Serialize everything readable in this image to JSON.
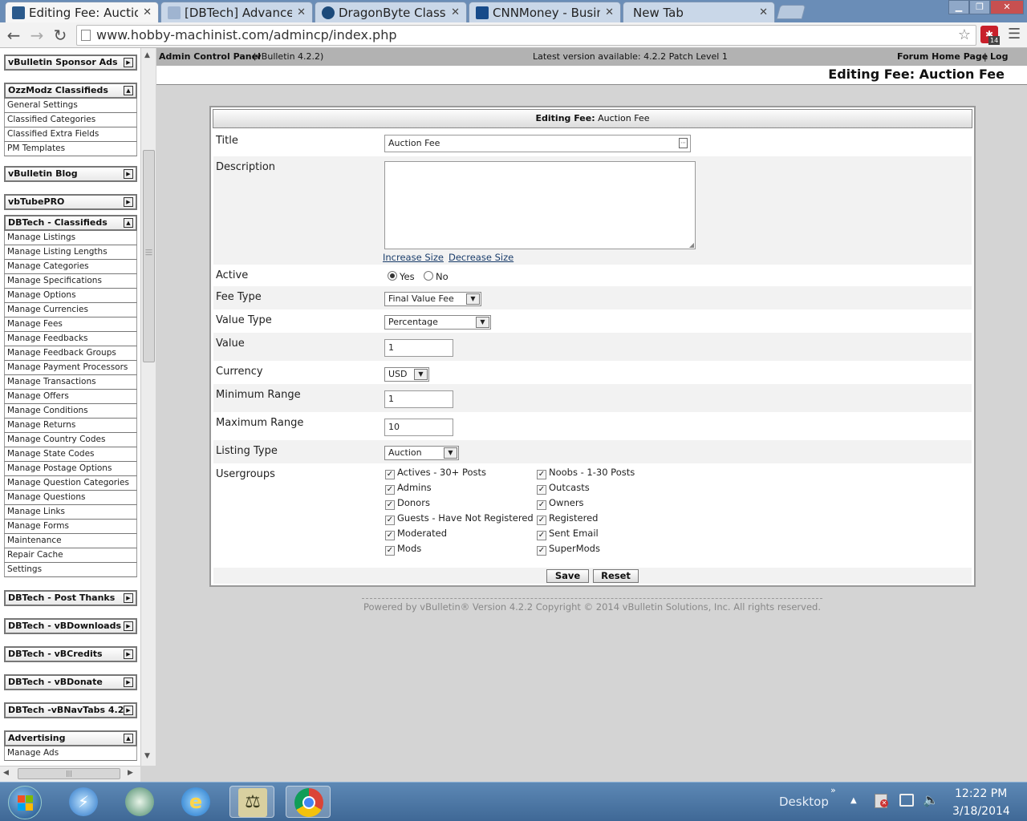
{
  "browser": {
    "tabs": [
      {
        "label": "Editing Fee: Auction",
        "fav_color": "#2b5a8c"
      },
      {
        "label": "[DBTech] Advanced",
        "fav_color": "#9fb4d0"
      },
      {
        "label": "DragonByte Classifie",
        "fav_color": "#1c4a7a"
      },
      {
        "label": "CNNMoney - Busines",
        "fav_color": "#174b8a"
      },
      {
        "label": "New Tab",
        "fav_color": ""
      }
    ],
    "url": "www.hobby-machinist.com/admincp/index.php",
    "extension_badge": "14"
  },
  "sidebar": {
    "groups": [
      {
        "title": "vBulletin Sponsor Ads",
        "toggle": "▶",
        "items": []
      },
      {
        "title": "OzzModz Classifieds",
        "toggle": "▲",
        "items": [
          "General Settings",
          "Classified Categories",
          "Classified Extra Fields",
          "PM Templates"
        ]
      },
      {
        "title": "vBulletin Blog",
        "toggle": "▶",
        "items": []
      },
      {
        "title": "vbTubePRO",
        "toggle": "▶",
        "items": []
      },
      {
        "title": "DBTech - Classifieds",
        "toggle": "▲",
        "items": [
          "Manage Listings",
          "Manage Listing Lengths",
          "Manage Categories",
          "Manage Specifications",
          "Manage Options",
          "Manage Currencies",
          "Manage Fees",
          "Manage Feedbacks",
          "Manage Feedback Groups",
          "Manage Payment Processors",
          "Manage Transactions",
          "Manage Offers",
          "Manage Conditions",
          "Manage Returns",
          "Manage Country Codes",
          "Manage State Codes",
          "Manage Postage Options",
          "Manage Question Categories",
          "Manage Questions",
          "Manage Links",
          "Manage Forms",
          "Maintenance",
          "Repair Cache",
          "Settings"
        ]
      },
      {
        "title": "DBTech - Post Thanks",
        "toggle": "▶",
        "items": []
      },
      {
        "title": "DBTech - vBDownloads",
        "toggle": "▶",
        "items": []
      },
      {
        "title": "DBTech - vBCredits",
        "toggle": "▶",
        "items": []
      },
      {
        "title": "DBTech - vBDonate",
        "toggle": "▶",
        "items": []
      },
      {
        "title": "DBTech -vBNavTabs 4.2",
        "toggle": "▶",
        "items": []
      },
      {
        "title": "Advertising",
        "toggle": "▲",
        "items": [
          "Manage Ads"
        ]
      }
    ]
  },
  "header": {
    "acp": "Admin Control Panel",
    "version": "(vBulletin 4.2.2)",
    "latest": "Latest version available: 4.2.2 Patch Level 1",
    "forum_home": "Forum Home Page",
    "sep": "|",
    "logout": "Log Out",
    "page_title": "Editing Fee: Auction Fee"
  },
  "form": {
    "heading_bold": "Editing Fee:",
    "heading_rest": " Auction Fee",
    "title_label": "Title",
    "title_value": "Auction Fee",
    "description_label": "Description",
    "description_value": "",
    "increase": "Increase Size",
    "decrease": "Decrease Size",
    "active_label": "Active",
    "yes": "Yes",
    "no": "No",
    "fee_type_label": "Fee Type",
    "fee_type_value": "Final Value Fee",
    "value_type_label": "Value Type",
    "value_type_value": "Percentage",
    "value_label": "Value",
    "value_value": "1",
    "currency_label": "Currency",
    "currency_value": "USD",
    "min_label": "Minimum Range",
    "min_value": "1",
    "max_label": "Maximum Range",
    "max_value": "10",
    "listing_label": "Listing Type",
    "listing_value": "Auction",
    "usergroups_label": "Usergroups",
    "usergroups_left": [
      "Actives - 30+ Posts",
      "Admins",
      "Donors",
      "Guests - Have Not Registered",
      "Moderated",
      "Mods"
    ],
    "usergroups_right": [
      "Noobs - 1-30 Posts",
      "Outcasts",
      "Owners",
      "Registered",
      "Sent Email",
      "SuperMods"
    ],
    "save": "Save",
    "reset": "Reset"
  },
  "footer": "Powered by vBulletin® Version 4.2.2 Copyright © 2014 vBulletin Solutions, Inc. All rights reserved.",
  "taskbar": {
    "desktop": "Desktop",
    "time": "12:22 PM",
    "date": "3/18/2014"
  }
}
